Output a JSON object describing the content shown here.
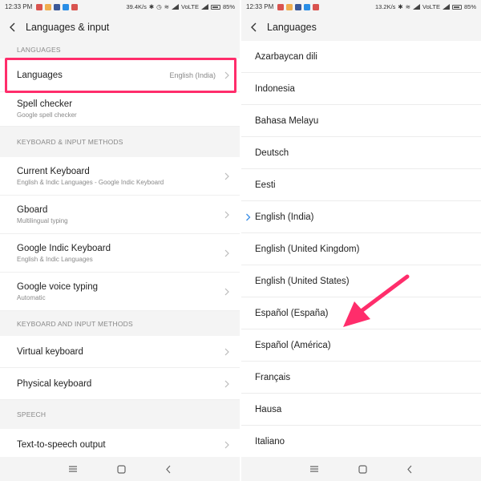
{
  "colors": {
    "highlight": "#ff2d6b",
    "accent": "#3a8ee6"
  },
  "left": {
    "status": {
      "time": "12:33 PM",
      "speed": "39.4K/s",
      "network": "VoLTE",
      "battery": "85%"
    },
    "title": "Languages & input",
    "sections": [
      {
        "header": "LANGUAGES",
        "items": [
          {
            "title": "Languages",
            "value": "English (India)",
            "icon": "chevron-right-icon"
          },
          {
            "title": "Spell checker",
            "subtitle": "Google spell checker"
          }
        ]
      },
      {
        "header": "KEYBOARD & INPUT METHODS",
        "items": [
          {
            "title": "Current Keyboard",
            "subtitle": "English & Indic Languages - Google Indic Keyboard",
            "icon": "chevron-right-icon"
          },
          {
            "title": "Gboard",
            "subtitle": "Multilingual typing",
            "icon": "chevron-right-icon"
          },
          {
            "title": "Google Indic Keyboard",
            "subtitle": "English & Indic Languages",
            "icon": "chevron-right-icon"
          },
          {
            "title": "Google voice typing",
            "subtitle": "Automatic",
            "icon": "chevron-right-icon"
          }
        ]
      },
      {
        "header": "KEYBOARD AND INPUT METHODS",
        "items": [
          {
            "title": "Virtual keyboard",
            "icon": "chevron-right-icon"
          },
          {
            "title": "Physical keyboard",
            "icon": "chevron-right-icon"
          }
        ]
      },
      {
        "header": "SPEECH",
        "items": [
          {
            "title": "Text-to-speech output",
            "icon": "chevron-right-icon"
          }
        ]
      }
    ]
  },
  "right": {
    "status": {
      "time": "12:33 PM",
      "speed": "13.2K/s",
      "network": "VoLTE",
      "battery": "85%"
    },
    "title": "Languages",
    "languages": [
      "Azarbaycan dili",
      "Indonesia",
      "Bahasa Melayu",
      "Deutsch",
      "Eesti",
      "English (India)",
      "English (United Kingdom)",
      "English (United States)",
      "Español (España)",
      "Español (América)",
      "Français",
      "Hausa",
      "Italiano"
    ],
    "selected_language": "English (India)"
  }
}
